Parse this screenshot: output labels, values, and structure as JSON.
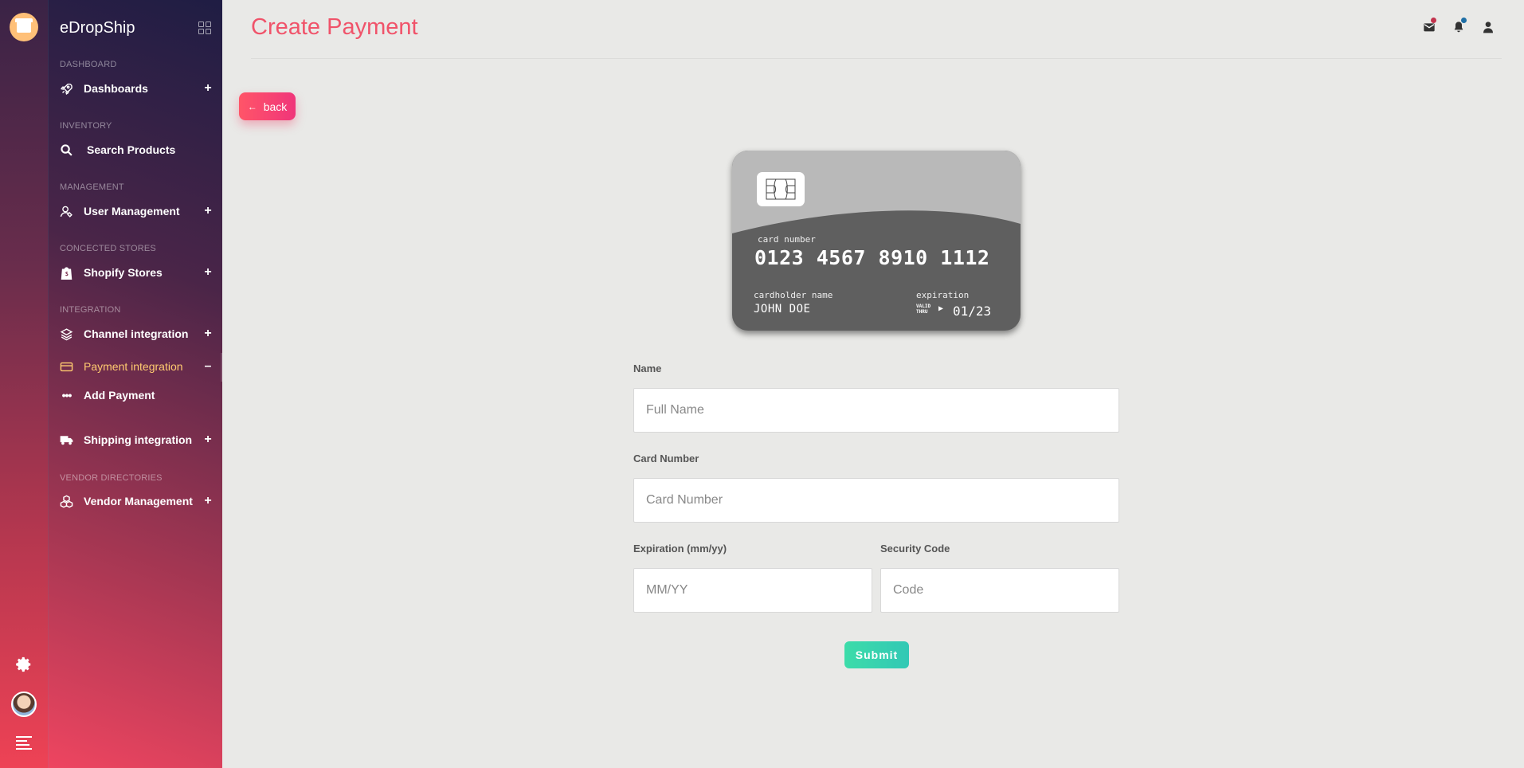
{
  "app": {
    "name": "eDropShip"
  },
  "sidebar": {
    "sections": [
      {
        "label": "DASHBOARD"
      },
      {
        "label": "INVENTORY"
      },
      {
        "label": "MANAGEMENT"
      },
      {
        "label": "CONCECTED STORES"
      },
      {
        "label": "INTEGRATION"
      },
      {
        "label": "VENDOR DIRECTORIES"
      }
    ],
    "items": [
      {
        "label": "Dashboards",
        "icon": "rocket-icon",
        "toggle": "+"
      },
      {
        "label": "Search Products",
        "icon": "search-icon",
        "toggle": ""
      },
      {
        "label": "User Management",
        "icon": "user-icon",
        "toggle": "+"
      },
      {
        "label": "Shopify Stores",
        "icon": "shopify-bag-icon",
        "toggle": "+"
      },
      {
        "label": "Channel integration",
        "icon": "layers-icon",
        "toggle": "+"
      },
      {
        "label": "Payment integration",
        "icon": "credit-card-icon",
        "toggle": "–"
      },
      {
        "label": "Add Payment",
        "icon": "ellipsis-icon",
        "toggle": ""
      },
      {
        "label": "Shipping integration",
        "icon": "truck-icon",
        "toggle": "+"
      },
      {
        "label": "Vendor Management",
        "icon": "cubes-icon",
        "toggle": "+"
      }
    ]
  },
  "header": {
    "title": "Create Payment"
  },
  "back_button": {
    "label": "back"
  },
  "card": {
    "number_label": "card number",
    "number": "0123 4567 8910 1112",
    "holder_label": "cardholder name",
    "holder": "JOHN DOE",
    "expiration_label": "expiration",
    "valid_line1": "VALID",
    "valid_line2": "THRU",
    "expiration": "01/23"
  },
  "form": {
    "name": {
      "label": "Name",
      "placeholder": "Full Name",
      "value": ""
    },
    "card_number": {
      "label": "Card Number",
      "placeholder": "Card Number",
      "value": ""
    },
    "expiration": {
      "label": "Expiration (mm/yy)",
      "placeholder": "MM/YY",
      "value": ""
    },
    "security": {
      "label": "Security Code",
      "placeholder": "Code",
      "value": ""
    },
    "submit_label": "Submit"
  },
  "colors": {
    "accent": "#f0536a",
    "submit": "#3cdca9",
    "active_nav": "#ffcb70",
    "mail_dot": "#c2334d",
    "bell_dot": "#1f6fa6"
  }
}
